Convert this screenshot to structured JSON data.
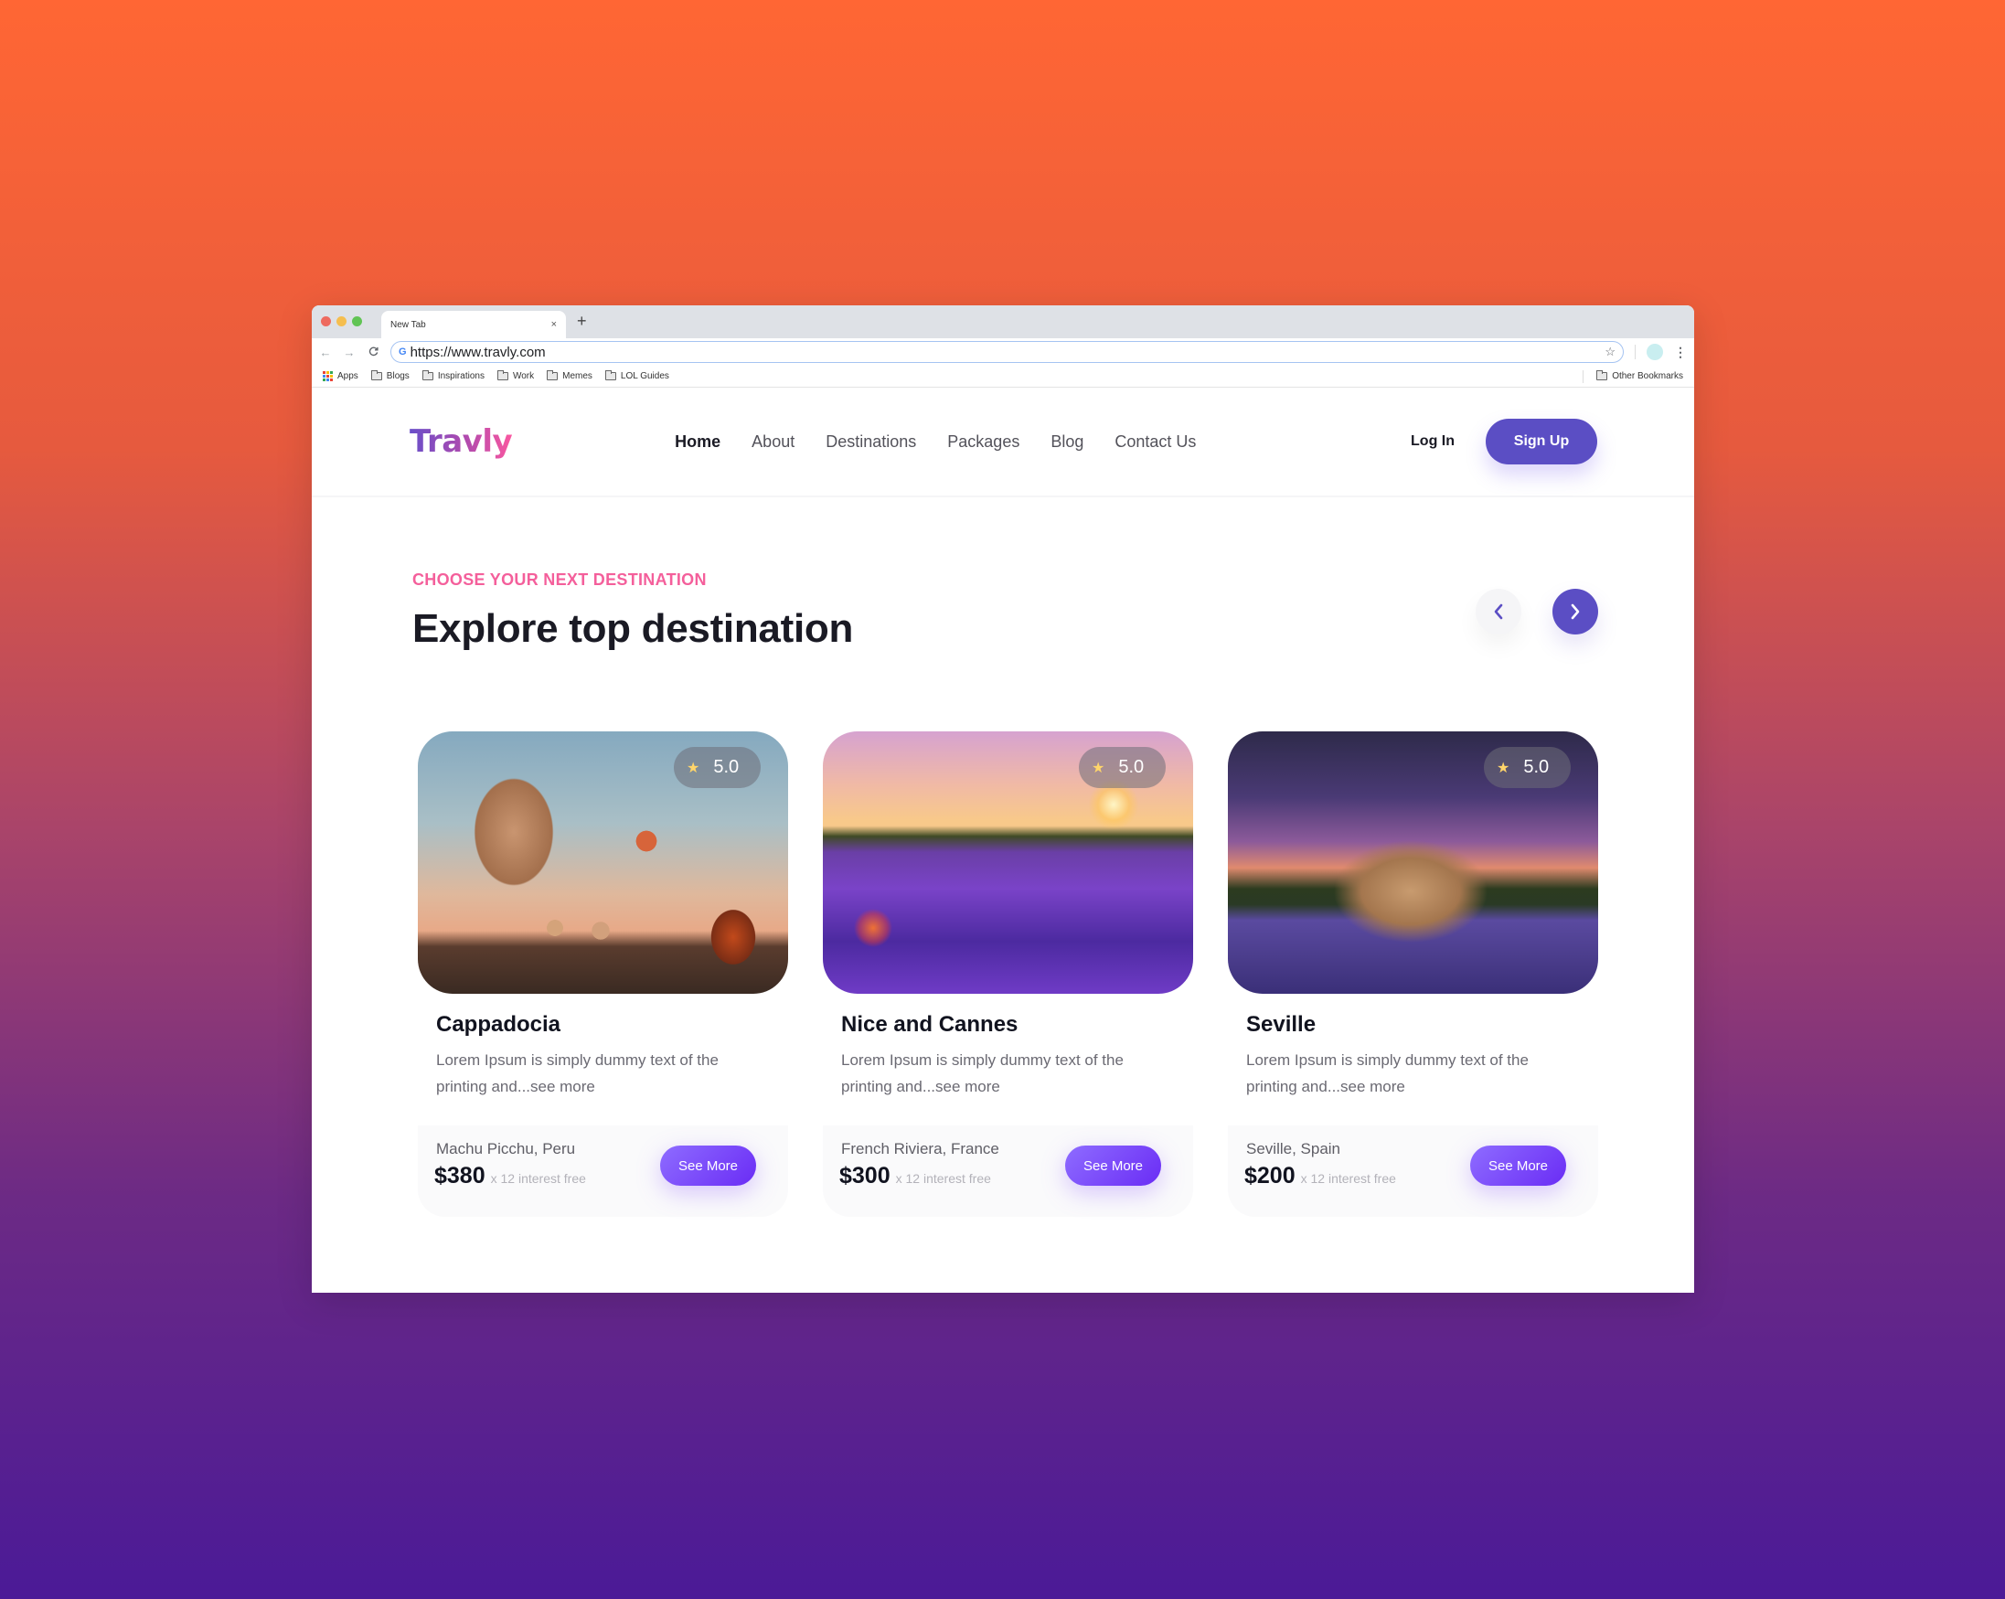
{
  "browser": {
    "tab_title": "New Tab",
    "tab_close": "×",
    "new_tab": "+",
    "url": "https://www.travly.com",
    "nav": {
      "back": "←",
      "forward": "→",
      "reload": "C"
    },
    "bookmarks": [
      {
        "label": "Apps",
        "icon": "apps-icon"
      },
      {
        "label": "Blogs",
        "icon": "folder-icon"
      },
      {
        "label": "Inspirations",
        "icon": "folder-icon"
      },
      {
        "label": "Work",
        "icon": "folder-icon"
      },
      {
        "label": "Memes",
        "icon": "folder-icon"
      },
      {
        "label": "LOL Guides",
        "icon": "folder-icon"
      }
    ],
    "other_bookmarks": "Other Bookmarks"
  },
  "site": {
    "logo": "Travly",
    "menu": [
      {
        "label": "Home",
        "active": true
      },
      {
        "label": "About"
      },
      {
        "label": "Destinations"
      },
      {
        "label": "Packages"
      },
      {
        "label": "Blog"
      },
      {
        "label": "Contact Us"
      }
    ],
    "login_label": "Log In",
    "signup_label": "Sign Up"
  },
  "section": {
    "eyebrow": "CHOOSE YOUR NEXT DESTINATION",
    "title": "Explore top destination",
    "prev_icon": "chevron-left-icon",
    "next_icon": "chevron-right-icon"
  },
  "cards": [
    {
      "rating": "5.0",
      "title": "Cappadocia",
      "description": "Lorem Ipsum is simply dummy text of the printing and...see more",
      "location": "Machu Picchu, Peru",
      "price": "$380",
      "installments": "x 12 interest free",
      "button": "See More",
      "image": "hot-air-balloons"
    },
    {
      "rating": "5.0",
      "title": "Nice and Cannes",
      "description": "Lorem Ipsum is simply dummy text of the printing and...see more",
      "location": "French Riviera, France",
      "price": "$300",
      "installments": "x 12 interest free",
      "button": "See More",
      "image": "lavender-field-sunset"
    },
    {
      "rating": "5.0",
      "title": "Seville",
      "description": "Lorem Ipsum is simply dummy text of the printing and...see more",
      "location": "Seville, Spain",
      "price": "$200",
      "installments": "x 12 interest free",
      "button": "See More",
      "image": "palace-reflection-night"
    }
  ],
  "colors": {
    "brand_purple": "#5b4ec4",
    "accent_pink": "#f45f9b",
    "star_yellow": "#ffd56a",
    "bg_gradient_top": "#ff6634",
    "bg_gradient_bottom": "#4b1a97"
  }
}
